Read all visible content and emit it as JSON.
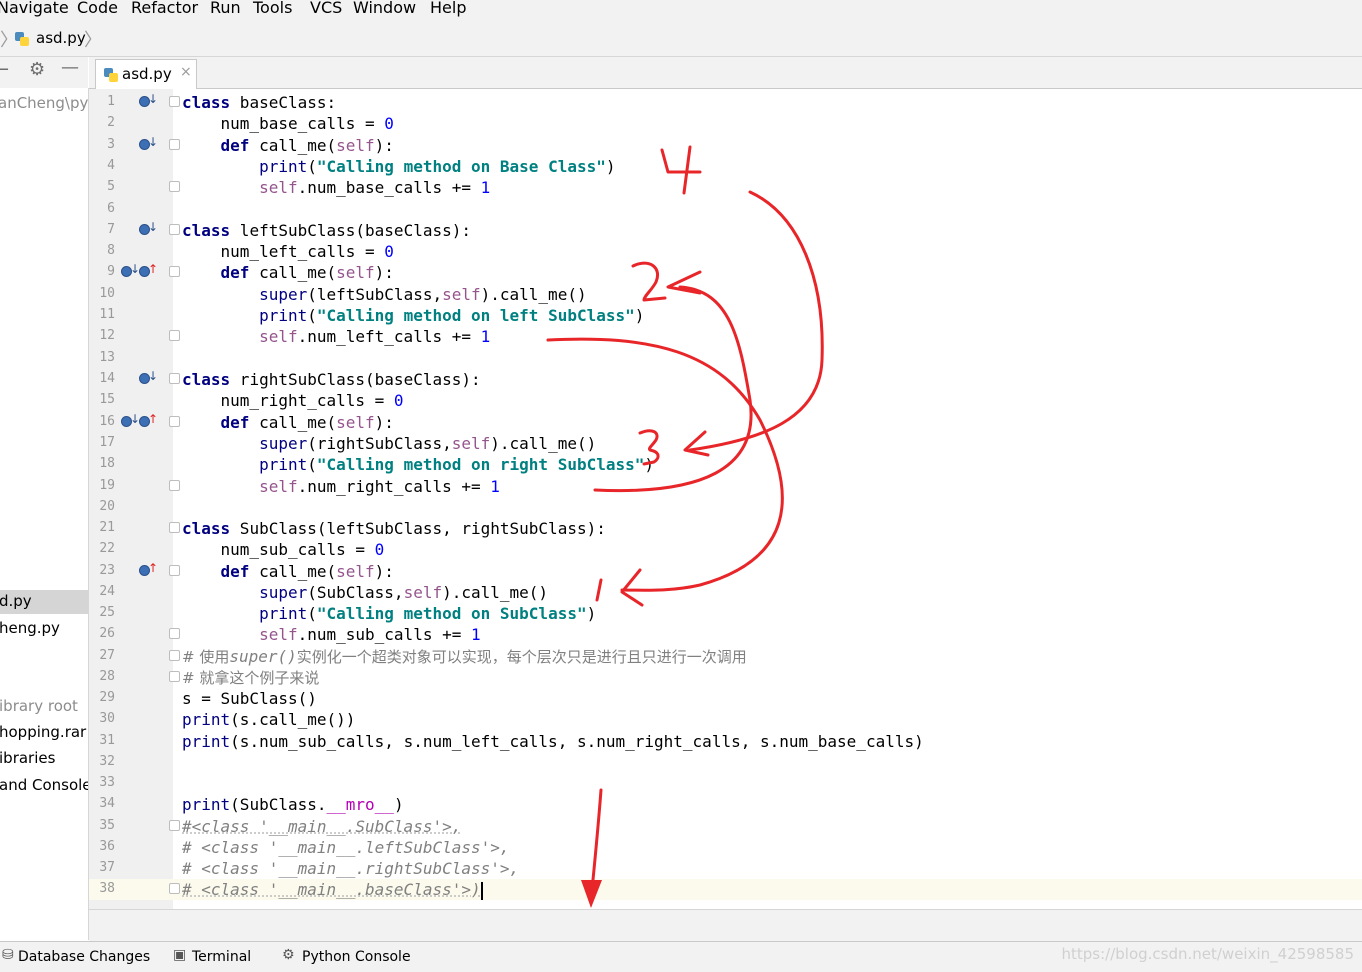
{
  "menu": {
    "items": [
      {
        "label": "Navigate",
        "mnemonic": "N"
      },
      {
        "label": "Code",
        "mnemonic": "C"
      },
      {
        "label": "Refactor",
        "mnemonic": "R"
      },
      {
        "label": "Run",
        "mnemonic": "u"
      },
      {
        "label": "Tools",
        "mnemonic": "T"
      },
      {
        "label": "VCS",
        "mnemonic": "S"
      },
      {
        "label": "Window",
        "mnemonic": "W"
      },
      {
        "label": "Help",
        "mnemonic": "H"
      }
    ]
  },
  "breadcrumb": {
    "file": "asd.py"
  },
  "project_panel": {
    "rows": [
      {
        "label": "anCheng\\pyt",
        "style": "gray"
      },
      {
        "label": "d.py",
        "style": "sel"
      },
      {
        "label": "heng.py",
        "style": "normal"
      },
      {
        "label": "ibrary root",
        "style": "gray"
      },
      {
        "label": "hopping.rar",
        "style": "normal"
      },
      {
        "label": "ibraries",
        "style": "normal"
      },
      {
        "label": " and Console",
        "style": "normal"
      }
    ]
  },
  "editor_tab": {
    "label": "asd.py",
    "close": "×"
  },
  "editor": {
    "current_line": 38,
    "lines": [
      {
        "n": "1"
      },
      {
        "n": "2"
      },
      {
        "n": "3"
      },
      {
        "n": "4"
      },
      {
        "n": "5"
      },
      {
        "n": "6"
      },
      {
        "n": "7"
      },
      {
        "n": "8"
      },
      {
        "n": "9"
      },
      {
        "n": "10"
      },
      {
        "n": "11"
      },
      {
        "n": "12"
      },
      {
        "n": "13"
      },
      {
        "n": "14"
      },
      {
        "n": "15"
      },
      {
        "n": "16"
      },
      {
        "n": "17"
      },
      {
        "n": "18"
      },
      {
        "n": "19"
      },
      {
        "n": "20"
      },
      {
        "n": "21"
      },
      {
        "n": "22"
      },
      {
        "n": "23"
      },
      {
        "n": "24"
      },
      {
        "n": "25"
      },
      {
        "n": "26"
      },
      {
        "n": "27"
      },
      {
        "n": "28"
      },
      {
        "n": "29"
      },
      {
        "n": "30"
      },
      {
        "n": "31"
      },
      {
        "n": "32"
      },
      {
        "n": "33"
      },
      {
        "n": "34"
      },
      {
        "n": "35"
      },
      {
        "n": "36"
      },
      {
        "n": "37"
      },
      {
        "n": "38"
      }
    ]
  },
  "code_text": {
    "l1": [
      "class",
      " baseClass:"
    ],
    "l2": [
      "    num_base_calls = ",
      "0"
    ],
    "l3": [
      "    ",
      "def",
      " call_me(",
      "self",
      "):"
    ],
    "l4": [
      "        ",
      "print",
      "(",
      "\"Calling method on Base Class\"",
      ")"
    ],
    "l5": [
      "        ",
      "self",
      ".num_base_calls += ",
      "1"
    ],
    "l7": [
      "class",
      " leftSubClass(baseClass):"
    ],
    "l8": [
      "    num_left_calls = ",
      "0"
    ],
    "l9": [
      "    ",
      "def",
      " call_me(",
      "self",
      "):"
    ],
    "l10": [
      "        ",
      "super",
      "(leftSubClass,",
      "self",
      ").call_me()"
    ],
    "l11": [
      "        ",
      "print",
      "(",
      "\"Calling method on left SubClass\"",
      ")"
    ],
    "l12": [
      "        ",
      "self",
      ".num_left_calls += ",
      "1"
    ],
    "l14": [
      "class",
      " rightSubClass(baseClass):"
    ],
    "l15": [
      "    num_right_calls = ",
      "0"
    ],
    "l16": [
      "    ",
      "def",
      " call_me(",
      "self",
      "):"
    ],
    "l17": [
      "        ",
      "super",
      "(rightSubClass,",
      "self",
      ").call_me()"
    ],
    "l18": [
      "        ",
      "print",
      "(",
      "\"Calling method on right SubClass\"",
      ")"
    ],
    "l19": [
      "        ",
      "self",
      ".num_right_calls += ",
      "1"
    ],
    "l21": [
      "class",
      " SubClass(leftSubClass, rightSubClass):"
    ],
    "l22": [
      "    num_sub_calls = ",
      "0"
    ],
    "l23": [
      "    ",
      "def",
      " call_me(",
      "self",
      "):"
    ],
    "l24": [
      "        ",
      "super",
      "(SubClass,",
      "self",
      ").call_me()"
    ],
    "l25": [
      "        ",
      "print",
      "(",
      "\"Calling method on SubClass\"",
      ")"
    ],
    "l26": [
      "        ",
      "self",
      ".num_sub_calls += ",
      "1"
    ],
    "l27": [
      "# 使用",
      "super()",
      "实例化一个超类对象可以实现，每个层次只是进行且只进行一次调用"
    ],
    "l28": [
      "# 就拿这个例子来说"
    ],
    "l29": [
      "s = SubClass()"
    ],
    "l30": [
      "print",
      "(s.call_me())"
    ],
    "l31": [
      "print",
      "(s.num_sub_calls, s.num_left_calls, s.num_right_calls, s.num_base_calls)"
    ],
    "l34": [
      "print",
      "(SubClass.",
      "__mro__",
      ")"
    ],
    "l35": [
      "#<class '__main__.SubClass'>,"
    ],
    "l36": [
      "# <class '__main__.leftSubClass'>,"
    ],
    "l37": [
      "# <class '__main__.rightSubClass'>,"
    ],
    "l38": [
      "# <class '__main__.baseClass'>)"
    ]
  },
  "annotations": {
    "n1": "1",
    "n2": "2",
    "n3": "3",
    "n4": "4"
  },
  "statusbar": {
    "items": [
      {
        "label": "Database Changes",
        "icon": "database-icon"
      },
      {
        "label": "Terminal",
        "icon": "terminal-icon"
      },
      {
        "label": "Python Console",
        "icon": "python-console-icon"
      }
    ],
    "watermark": "https://blog.csdn.net/weixin_42598585"
  },
  "colors": {
    "keyword": "#000080",
    "string": "#008080",
    "number": "#0000ff",
    "self": "#94558d",
    "comment": "#808080",
    "annotation_red": "#e8262a"
  }
}
